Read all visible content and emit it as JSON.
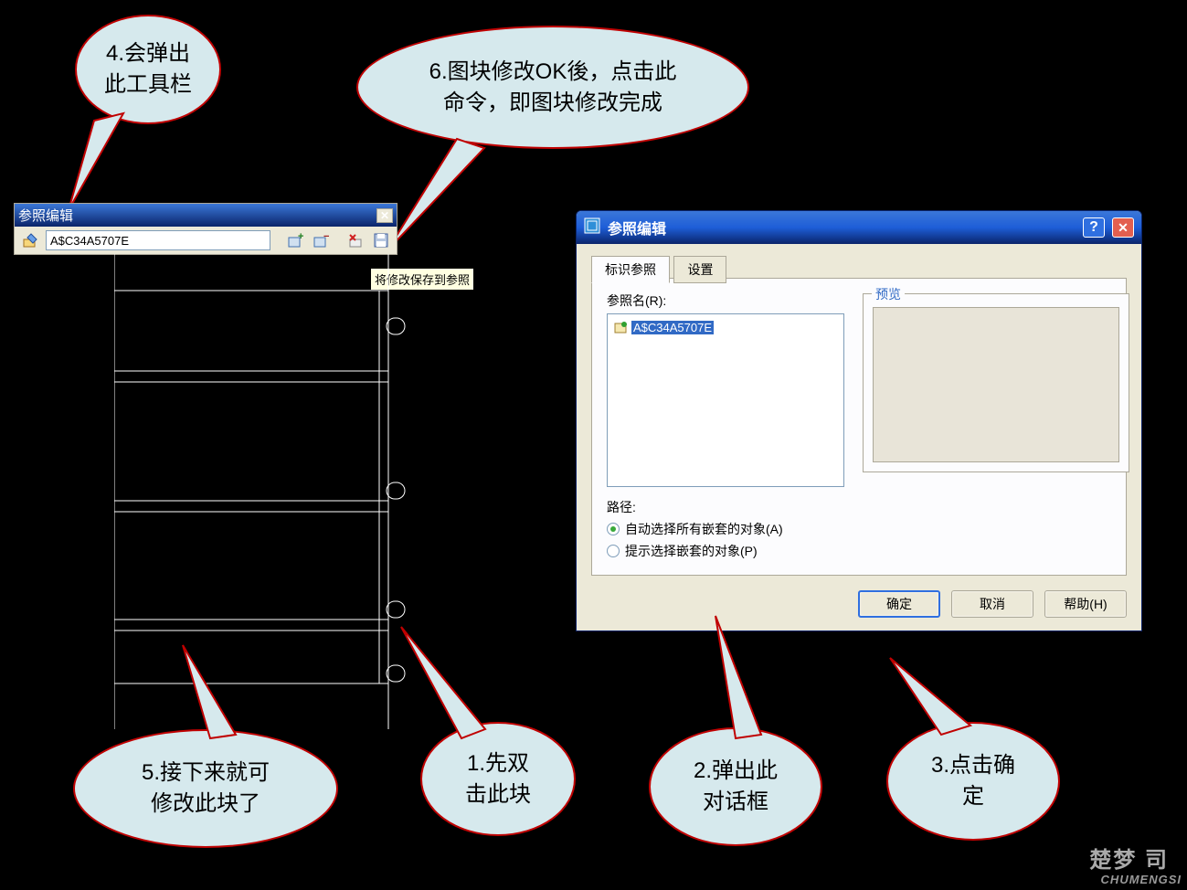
{
  "toolbar": {
    "title": "参照编辑",
    "input_value": "A$C34A5707E",
    "tooltip": "将修改保存到参照"
  },
  "dialog": {
    "title": "参照编辑",
    "tabs": {
      "identify": "标识参照",
      "settings": "设置"
    },
    "ref_name_label": "参照名(R):",
    "ref_name_value": "A$C34A5707E",
    "preview_label": "预览",
    "path_label": "路径:",
    "radio_auto": "自动选择所有嵌套的对象(A)",
    "radio_prompt": "提示选择嵌套的对象(P)",
    "btn_ok": "确定",
    "btn_cancel": "取消",
    "btn_help": "帮助(H)"
  },
  "callouts": {
    "c1": {
      "l1": "1.先双",
      "l2": "击此块"
    },
    "c2": {
      "l1": "2.弹出此",
      "l2": "对话框"
    },
    "c3": {
      "l1": "3.点击确",
      "l2": "定"
    },
    "c4": {
      "l1": "4.会弹出",
      "l2": "此工具栏"
    },
    "c5": {
      "l1": "5.接下来就可",
      "l2": "修改此块了"
    },
    "c6": {
      "l1": "6.图块修改OK後，点击此",
      "l2": "命令，即图块修改完成"
    }
  },
  "watermark": {
    "cn": "楚梦 司",
    "en": "CHUMENGSI"
  }
}
